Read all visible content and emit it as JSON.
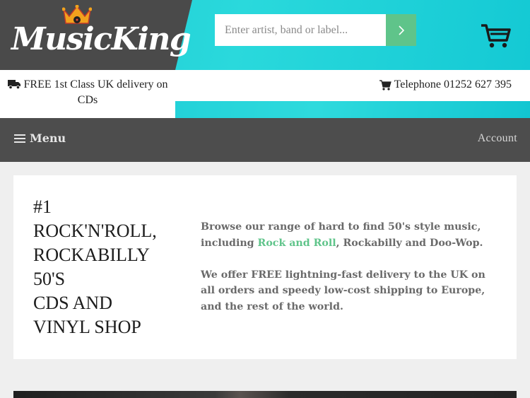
{
  "brand": {
    "name": "MusicKing"
  },
  "search": {
    "placeholder": "Enter artist, band or label..."
  },
  "info": {
    "delivery_text": "FREE 1st Class UK delivery on CDs",
    "phone_text": "Telephone 01252 627 395"
  },
  "nav": {
    "menu_label": "Menu",
    "account_label": "Account"
  },
  "hero": {
    "title_lines": [
      "#1",
      "ROCK'N'ROLL,",
      "ROCKABILLY",
      "50'S",
      "CDS AND",
      "VINYL SHOP"
    ],
    "para1_before": "Browse our range of hard to find 50's style music, including ",
    "para1_link": "Rock and Roll",
    "para1_after": ", Rockabilly and Doo-Wop.",
    "para2": "We offer FREE lightning-fast delivery to the UK on all orders and speedy low-cost shipping to Europe, and the rest of the world."
  },
  "colors": {
    "accent_teal": "#1bc7d1",
    "accent_green": "#5fc48a",
    "dark": "#4d4d4d"
  },
  "icons": [
    "crown-icon",
    "search-arrow-icon",
    "cart-icon",
    "truck-icon",
    "cart-small-icon",
    "hamburger-icon"
  ]
}
